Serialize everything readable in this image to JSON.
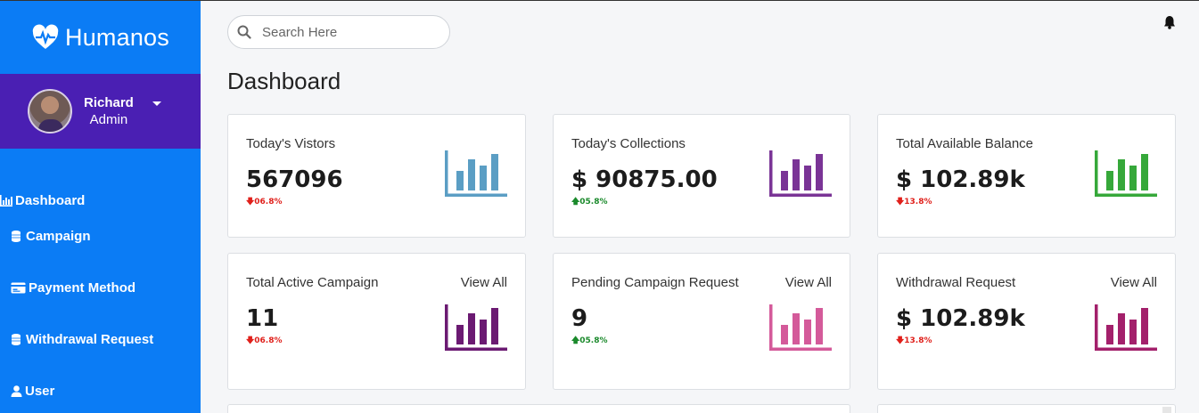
{
  "brand": {
    "name": "Humanos",
    "icon": "heartbeat-icon"
  },
  "profile": {
    "name": "Richard",
    "role": "Admin"
  },
  "nav": [
    {
      "label": "Dashboard",
      "icon": "bar-chart-icon"
    },
    {
      "label": "Campaign",
      "icon": "database-icon"
    },
    {
      "label": "Payment Method",
      "icon": "credit-card-icon"
    },
    {
      "label": "Withdrawal Request",
      "icon": "database-icon"
    },
    {
      "label": "User",
      "icon": "user-icon"
    }
  ],
  "search": {
    "placeholder": "Search Here"
  },
  "page_title": "Dashboard",
  "cards": [
    {
      "label": "Today's Vistors",
      "value": "567096",
      "change": "06.8%",
      "trend": "down",
      "color": "#5b9ec4"
    },
    {
      "label": "Today's Collections",
      "value": "$ 90875.00",
      "change": "05.8%",
      "trend": "up",
      "color": "#7a3496"
    },
    {
      "label": "Total Available Balance",
      "value": "$ 102.89k",
      "change": "13.8%",
      "trend": "down",
      "color": "#36a83a"
    },
    {
      "label": "Total Active Campaign",
      "link": "View All",
      "value": "11",
      "change": "06.8%",
      "trend": "down",
      "color": "#6b1a72"
    },
    {
      "label": "Pending Campaign Request",
      "link": "View All",
      "value": "9",
      "change": "05.8%",
      "trend": "up",
      "color": "#d45a9a"
    },
    {
      "label": "Withdrawal Request",
      "link": "View All",
      "value": "$ 102.89k",
      "change": "13.8%",
      "trend": "down",
      "color": "#a3206b"
    }
  ],
  "colors": {
    "sidebar": "#0b7cf5",
    "profile_band": "#4a1fb3",
    "down": "#e0201b",
    "up": "#1b8a2c"
  }
}
